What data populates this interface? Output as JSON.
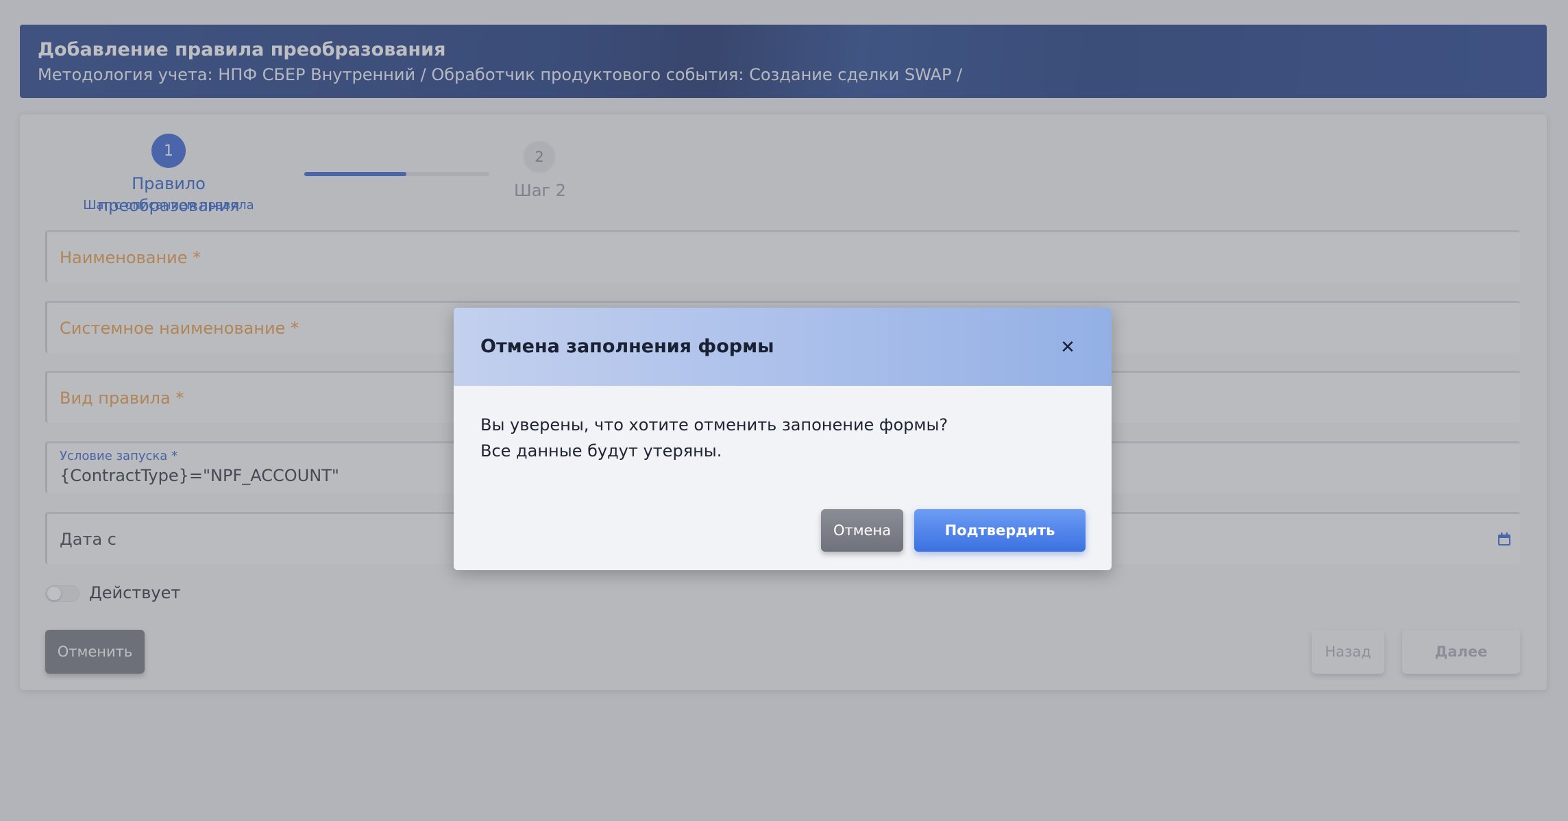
{
  "header": {
    "title": "Добавление правила преобразования",
    "breadcrumb": "Методология учета: НПФ СБЕР Внутренний / Обработчик продуктового события: Создание сделки SWAP /"
  },
  "stepper": {
    "progress": 0.55,
    "steps": [
      {
        "number": "1",
        "title": "Правило преобразования",
        "subtitle": "Шаг с описанием правила",
        "active": true
      },
      {
        "number": "2",
        "title": "Шаг 2",
        "active": false
      }
    ]
  },
  "form": {
    "name_placeholder": "Наименование *",
    "system_name_placeholder": "Системное наименование *",
    "rule_type_placeholder": "Вид правила *",
    "launch_condition": {
      "label": "Условие запуска *",
      "value": "{ContractType}=\"NPF_ACCOUNT\""
    },
    "date_from_label": "Дата с",
    "active_toggle_label": "Действует",
    "active_toggle_on": false
  },
  "buttons": {
    "cancel": "Отменить",
    "back": "Назад",
    "next": "Далее"
  },
  "modal": {
    "title": "Отмена заполнения формы",
    "close_glyph": "✕",
    "message_line1": "Вы уверены, что хотите отменить запонение формы?",
    "message_line2": "Все данные будут утеряны.",
    "cancel_label": "Отмена",
    "confirm_label": "Подтвердить"
  },
  "colors": {
    "primary": "#2e5bd3",
    "placeholder": "#e6963c",
    "header_bg": "#12307a"
  }
}
